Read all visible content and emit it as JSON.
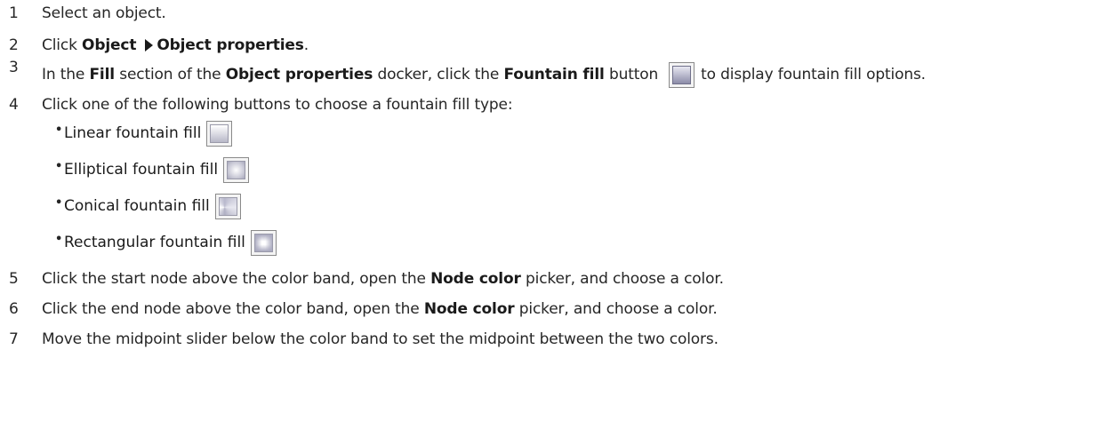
{
  "steps": [
    {
      "num": "1",
      "parts": [
        "Select an object."
      ]
    },
    {
      "num": "2",
      "click": "Click",
      "menu1": "Object",
      "menu2": "Object properties",
      "end": "."
    },
    {
      "num": "3",
      "t1": "In the",
      "fill": "Fill",
      "t2": "section of the",
      "docker": "Object properties",
      "t3": "docker, click the",
      "button": "Fountain fill",
      "t4": "button",
      "t5": "to display fountain fill options."
    },
    {
      "num": "4",
      "text": "Click one of the following buttons to choose a fountain fill type:"
    },
    {
      "num": "5",
      "t1": "Click the start node above the color band, open the",
      "picker": "Node color",
      "t2": "picker, and choose a color."
    },
    {
      "num": "6",
      "t1": "Click the end node above the color band, open the",
      "picker": "Node color",
      "t2": "picker, and choose a color."
    },
    {
      "num": "7",
      "text": "Move the midpoint slider below the color band to set the midpoint between the two colors."
    }
  ],
  "fill_types": [
    {
      "label": "Linear fountain fill",
      "icon": "linear-fountain-fill-icon"
    },
    {
      "label": "Elliptical fountain fill",
      "icon": "elliptical-fountain-fill-icon"
    },
    {
      "label": "Conical fountain fill",
      "icon": "conical-fountain-fill-icon"
    },
    {
      "label": "Rectangular fountain fill",
      "icon": "rectangular-fountain-fill-icon"
    }
  ],
  "bullet": "•"
}
